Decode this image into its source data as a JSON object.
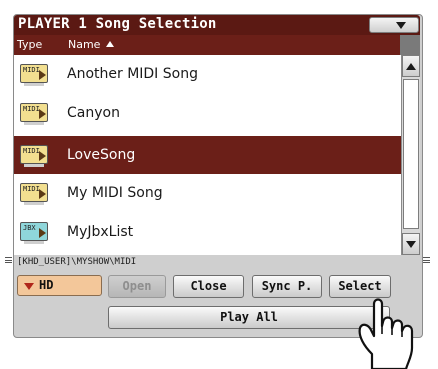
{
  "window": {
    "title": "PLAYER 1 Song Selection"
  },
  "columns": {
    "type": "Type",
    "name": "Name"
  },
  "files": [
    {
      "name": "Another MIDI Song",
      "icon": "midi-file-icon",
      "icon_label": "MIDI",
      "selected": false
    },
    {
      "name": "Canyon",
      "icon": "midi-file-icon",
      "icon_label": "MIDI",
      "selected": false
    },
    {
      "name": "LoveSong",
      "icon": "midi-file-icon",
      "icon_label": "MIDI",
      "selected": true
    },
    {
      "name": "My MIDI Song",
      "icon": "midi-file-icon",
      "icon_label": "MIDI",
      "selected": false
    },
    {
      "name": "MyJbxList",
      "icon": "jbx-file-icon",
      "icon_label": "JBX",
      "selected": false
    }
  ],
  "path": "[KHD_USER]\\MYSHOW\\MIDI",
  "device": {
    "selected": "HD"
  },
  "buttons": {
    "open": "Open",
    "close": "Close",
    "sync": "Sync P.",
    "select": "Select",
    "play_all": "Play All"
  },
  "colors": {
    "title_bar": "#5b1913",
    "selection": "#6b1f18",
    "panel": "#cfcfcf",
    "midi_icon": "#f2df90",
    "jbx_icon": "#8fd6da",
    "device_box": "#f3c79a"
  },
  "icons": {
    "dropdown": "chevron-down-icon",
    "sort": "sort-ascending-icon",
    "pointer": "hand-pointer-icon"
  }
}
